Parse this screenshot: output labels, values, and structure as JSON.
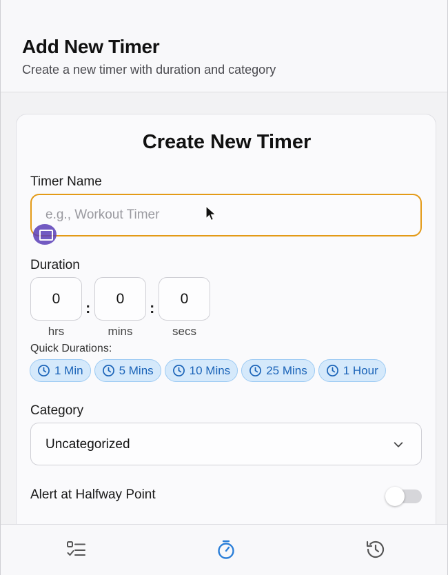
{
  "header": {
    "title": "Add New Timer",
    "subtitle": "Create a new timer with duration and category"
  },
  "form": {
    "card_title": "Create New Timer",
    "name_label": "Timer Name",
    "name_placeholder": "e.g., Workout Timer",
    "name_value": "",
    "duration_label": "Duration",
    "hours": "0",
    "minutes": "0",
    "seconds": "0",
    "hours_unit": "hrs",
    "minutes_unit": "mins",
    "seconds_unit": "secs",
    "quick_label": "Quick Durations:",
    "quick_durations": [
      "1 Min",
      "5 Mins",
      "10 Mins",
      "25 Mins",
      "1 Hour"
    ],
    "category_label": "Category",
    "category_value": "Uncategorized",
    "halfway_label": "Alert at Halfway Point",
    "halfway_enabled": false
  },
  "tabs": [
    {
      "icon": "checklist-icon",
      "active": false
    },
    {
      "icon": "stopwatch-icon",
      "active": true
    },
    {
      "icon": "history-icon",
      "active": false
    }
  ],
  "colors": {
    "accent": "#e39a17",
    "chip_bg": "#d5e9fb",
    "chip_text": "#1a63b8",
    "active_tab": "#2b7fd8",
    "inactive_tab": "#555555"
  }
}
